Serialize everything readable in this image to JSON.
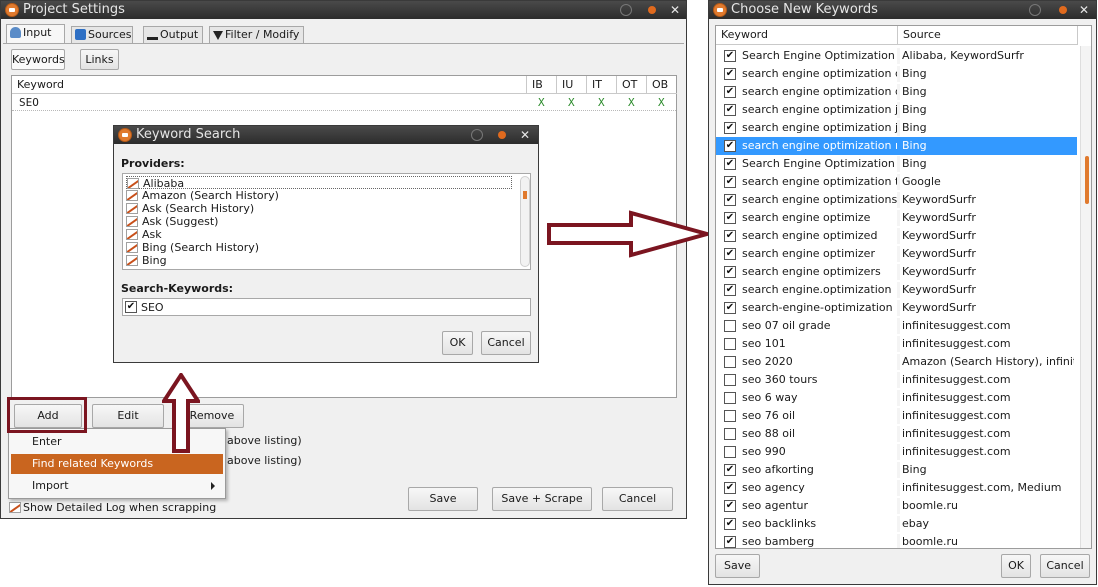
{
  "project_settings": {
    "title": "Project Settings",
    "tabs": [
      {
        "label": "Input",
        "icon": "input-icon"
      },
      {
        "label": "Sources",
        "icon": "sources-icon"
      },
      {
        "label": "Output",
        "icon": "output-icon"
      },
      {
        "label": "Filter / Modify",
        "icon": "filter-icon"
      }
    ],
    "subtabs": [
      "Keywords",
      "Links"
    ],
    "grid": {
      "columns": [
        "Keyword",
        "IB",
        "IU",
        "IT",
        "OT",
        "OB"
      ],
      "rows": [
        {
          "keyword": "SEO",
          "flags": [
            "X",
            "X",
            "X",
            "X",
            "X"
          ]
        }
      ]
    },
    "buttons": {
      "add": "Add",
      "edit": "Edit",
      "remove": "Remove"
    },
    "partial_options": [
      "above listing)",
      "above listing)"
    ],
    "show_log_label": "Show Detailed Log when scrapping",
    "footer": {
      "save": "Save",
      "save_scrape": "Save + Scrape",
      "cancel": "Cancel"
    },
    "add_menu": {
      "items": [
        "Enter",
        "Find related Keywords",
        "Import"
      ],
      "highlighted": "Find related Keywords",
      "highlight_color": "#c9651f"
    }
  },
  "keyword_search": {
    "title": "Keyword Search",
    "providers_label": "Providers:",
    "providers": [
      "Alibaba",
      "Amazon (Search History)",
      "Ask (Search History)",
      "Ask (Suggest)",
      "Ask",
      "Bing (Search History)",
      "Bing"
    ],
    "search_keywords_label": "Search-Keywords:",
    "search_keywords": [
      {
        "checked": true,
        "label": "SEO"
      }
    ],
    "ok": "OK",
    "cancel": "Cancel"
  },
  "choose_keywords": {
    "title": "Choose New Keywords",
    "columns": [
      "Keyword",
      "Source"
    ],
    "selected_color": "#3399ff",
    "rows": [
      {
        "checked": true,
        "keyword": "Search Engine Optimization",
        "source": "Alibaba, KeywordSurfr"
      },
      {
        "checked": true,
        "keyword": "search engine optimization c...",
        "source": "Bing"
      },
      {
        "checked": true,
        "keyword": "search engine optimization d...",
        "source": "Bing"
      },
      {
        "checked": true,
        "keyword": "search engine optimization j...",
        "source": "Bing"
      },
      {
        "checked": true,
        "keyword": "search engine optimization j...",
        "source": "Bing"
      },
      {
        "checked": true,
        "keyword": "search engine optimization m...",
        "source": "Bing",
        "selected": true
      },
      {
        "checked": true,
        "keyword": "Search Engine Optimization r...",
        "source": "Bing"
      },
      {
        "checked": true,
        "keyword": "search engine optimization tips",
        "source": "Google"
      },
      {
        "checked": true,
        "keyword": "search engine optimizations",
        "source": "KeywordSurfr"
      },
      {
        "checked": true,
        "keyword": "search engine optimize",
        "source": "KeywordSurfr"
      },
      {
        "checked": true,
        "keyword": "search engine optimized",
        "source": "KeywordSurfr"
      },
      {
        "checked": true,
        "keyword": "search engine optimizer",
        "source": "KeywordSurfr"
      },
      {
        "checked": true,
        "keyword": "search engine optimizers",
        "source": "KeywordSurfr"
      },
      {
        "checked": true,
        "keyword": "search engine.optimization",
        "source": "KeywordSurfr"
      },
      {
        "checked": true,
        "keyword": "search-engine-optimization",
        "source": "KeywordSurfr"
      },
      {
        "checked": false,
        "keyword": "seo 07 oil grade",
        "source": "infinitesuggest.com"
      },
      {
        "checked": false,
        "keyword": "seo 101",
        "source": "infinitesuggest.com"
      },
      {
        "checked": false,
        "keyword": "seo 2020",
        "source": "Amazon (Search History), infinit..."
      },
      {
        "checked": false,
        "keyword": "seo 360 tours",
        "source": "infinitesuggest.com"
      },
      {
        "checked": false,
        "keyword": "seo 6 way",
        "source": "infinitesuggest.com"
      },
      {
        "checked": false,
        "keyword": "seo 76 oil",
        "source": "infinitesuggest.com"
      },
      {
        "checked": false,
        "keyword": "seo 88 oil",
        "source": "infinitesuggest.com"
      },
      {
        "checked": false,
        "keyword": "seo 990",
        "source": "infinitesuggest.com"
      },
      {
        "checked": true,
        "keyword": "seo afkorting",
        "source": "Bing"
      },
      {
        "checked": true,
        "keyword": "seo agency",
        "source": "infinitesuggest.com, Medium"
      },
      {
        "checked": true,
        "keyword": "seo agentur",
        "source": "boomle.ru"
      },
      {
        "checked": true,
        "keyword": "seo backlinks",
        "source": "ebay"
      },
      {
        "checked": true,
        "keyword": "seo bamberg",
        "source": "boomle.ru"
      }
    ],
    "save": "Save",
    "ok": "OK",
    "cancel": "Cancel"
  },
  "annotations": {
    "color": "#7b1520"
  }
}
